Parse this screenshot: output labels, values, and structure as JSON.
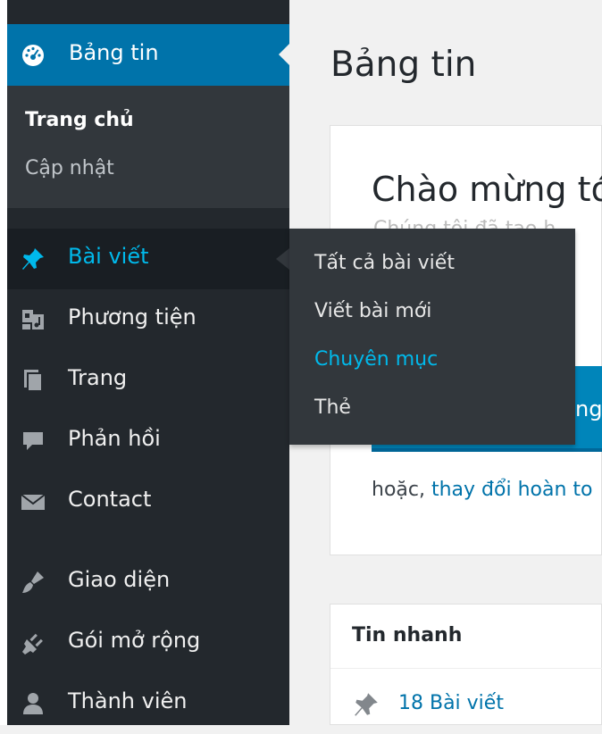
{
  "sidebar": {
    "dashboard": {
      "icon": "dashboard-icon",
      "label": "Bảng tin"
    },
    "dashboard_submenu": {
      "home": "Trang chủ",
      "updates": "Cập nhật"
    },
    "items": [
      {
        "icon": "pin-icon",
        "label": "Bài viết"
      },
      {
        "icon": "media-icon",
        "label": "Phương tiện"
      },
      {
        "icon": "page-icon",
        "label": "Trang"
      },
      {
        "icon": "comment-icon",
        "label": "Phản hồi"
      },
      {
        "icon": "mail-icon",
        "label": "Contact"
      },
      {
        "icon": "brush-icon",
        "label": "Giao diện"
      },
      {
        "icon": "plugin-icon",
        "label": "Gói mở rộng"
      },
      {
        "icon": "user-icon",
        "label": "Thành viên"
      }
    ]
  },
  "flyout": {
    "items": [
      "Tất cả bài viết",
      "Viết bài mới",
      "Chuyên mục",
      "Thẻ"
    ],
    "current": "Chuyên mục"
  },
  "main": {
    "title": "Bảng tin",
    "welcome": {
      "title": "Chào mừng tớ",
      "subtitle": "Chúng tôi đã tạo h",
      "button": "ng",
      "or_text": "hoặc,",
      "or_link": "thay đổi hoàn to"
    },
    "glance": {
      "title": "Tin nhanh",
      "posts": "18 Bài viết"
    }
  },
  "colors": {
    "sidebar_bg": "#23282d",
    "accent": "#0073aa",
    "highlight": "#00b9eb"
  }
}
